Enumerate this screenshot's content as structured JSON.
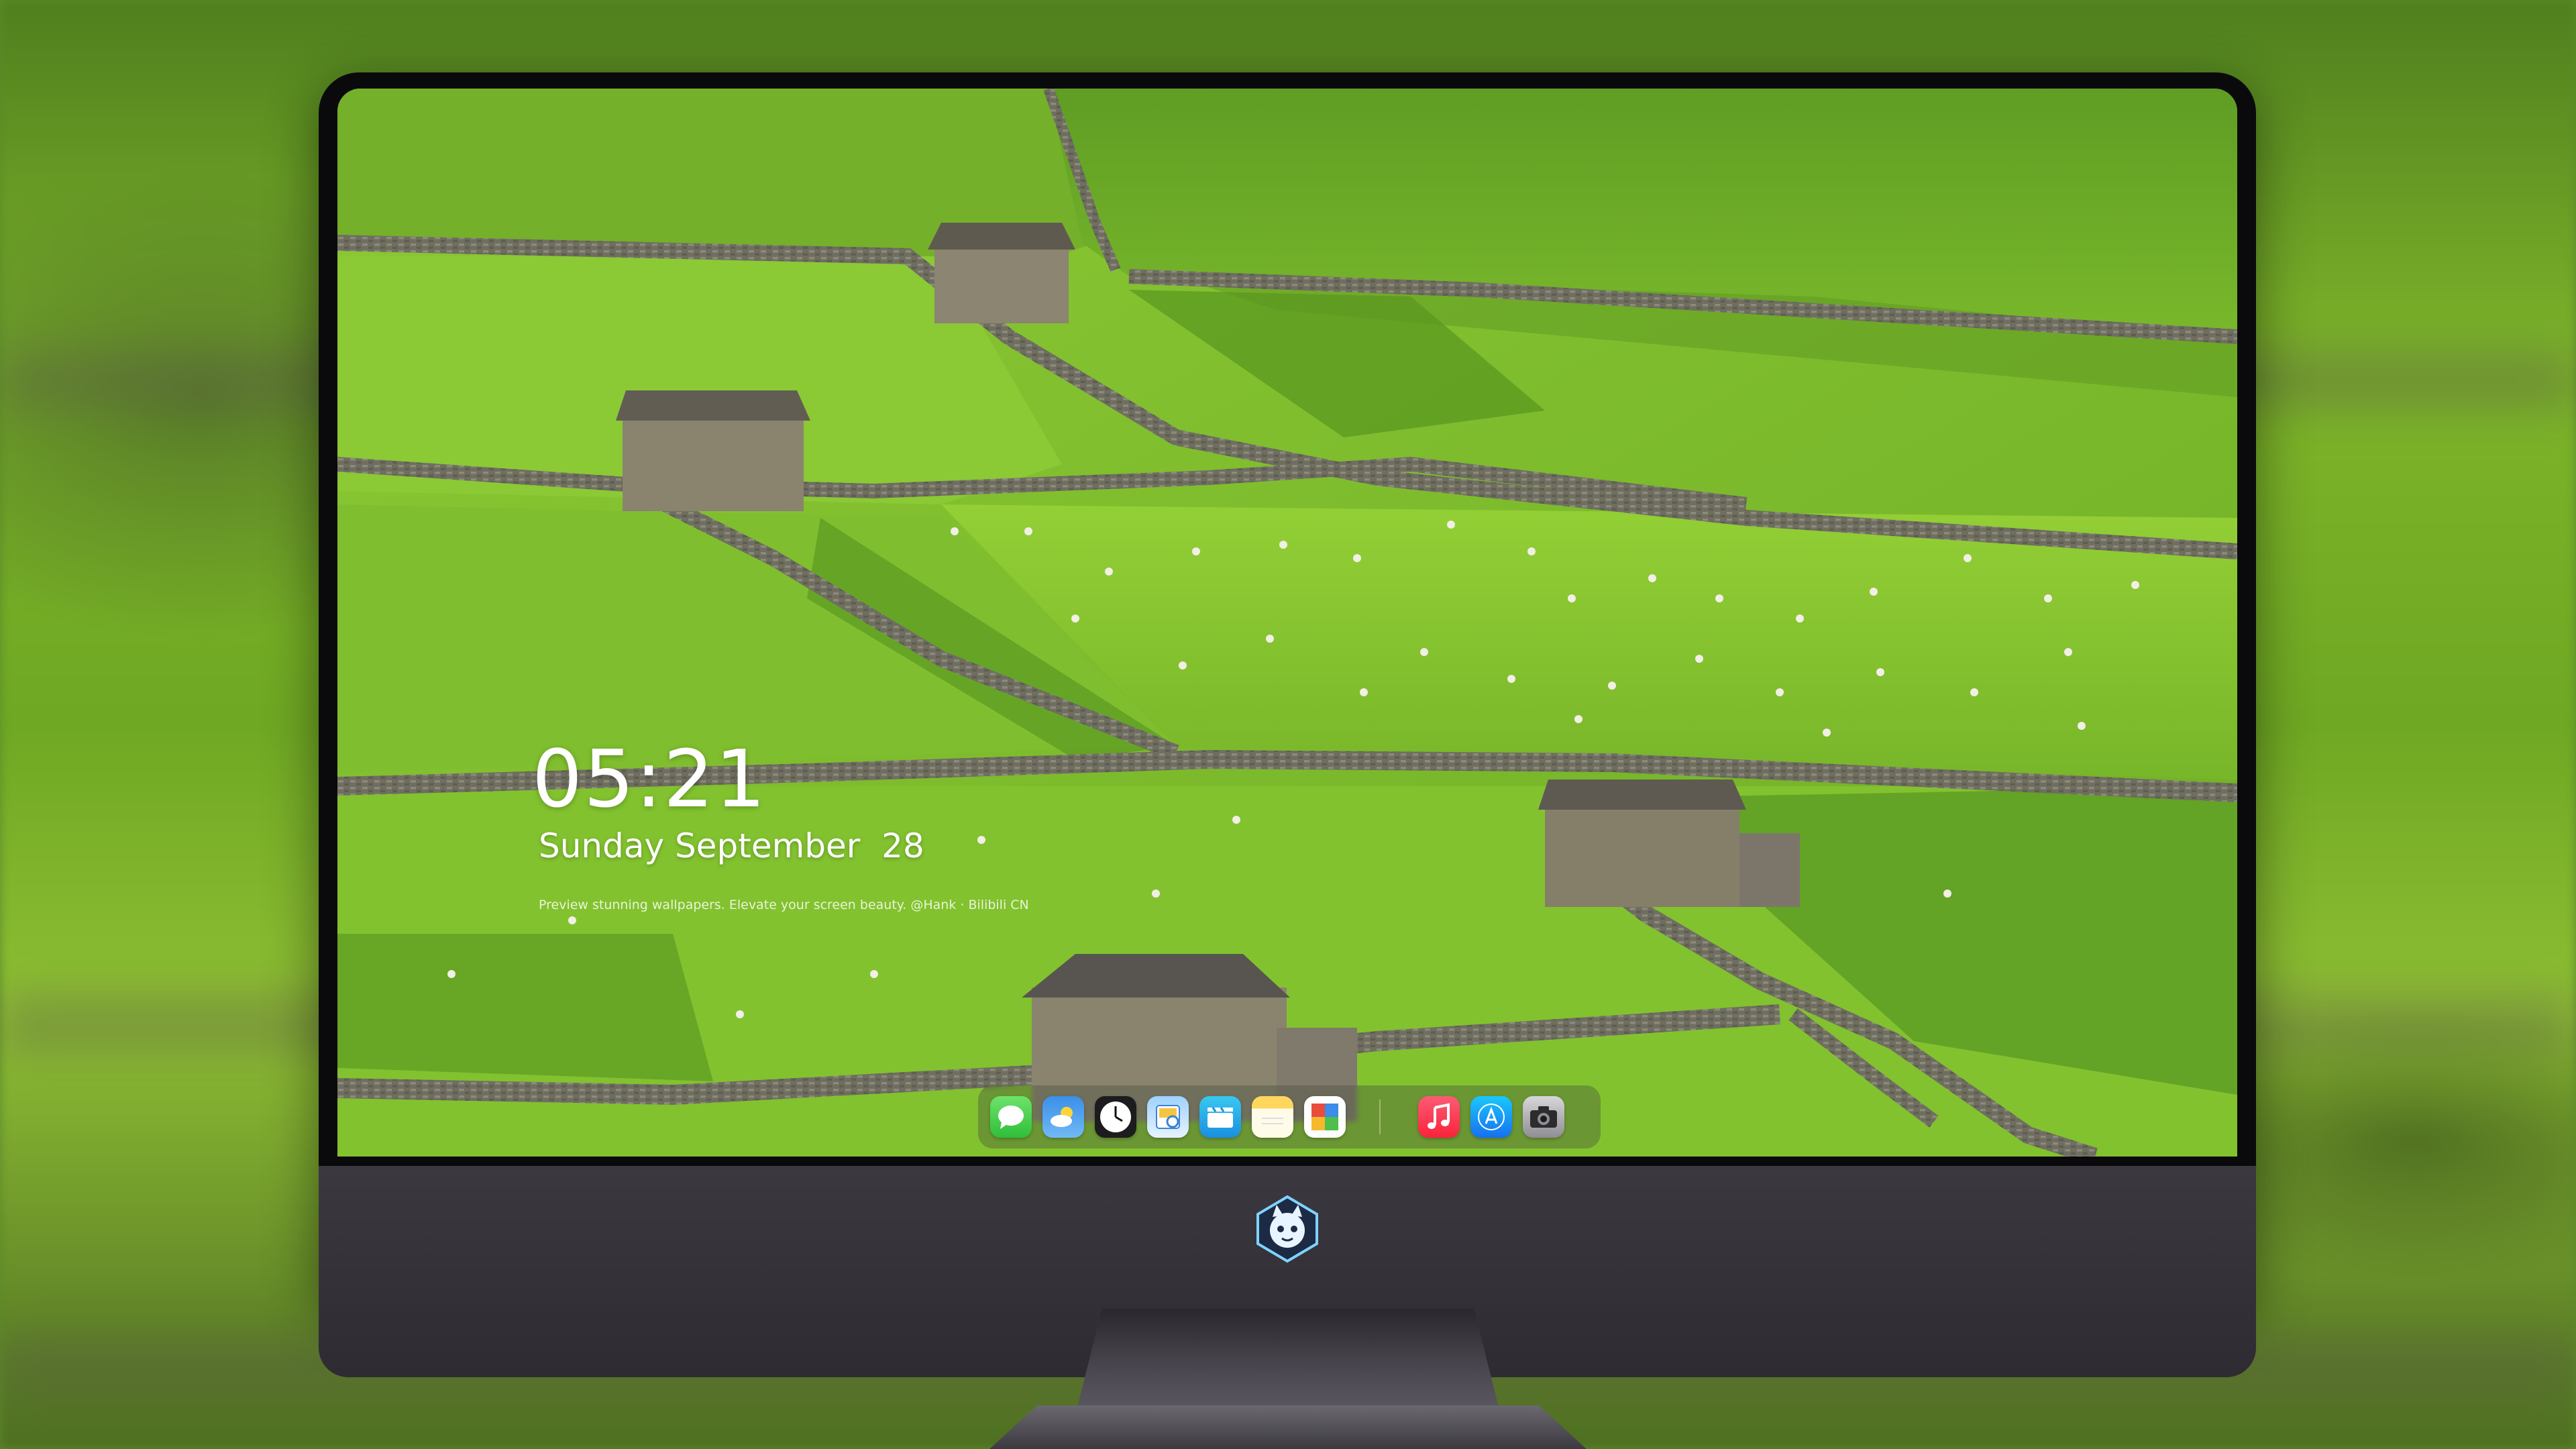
{
  "lock_screen": {
    "time": "05:21",
    "date": "Sunday September  28",
    "tagline": "Preview stunning wallpapers. Elevate your screen beauty. @Hank · Bilibili CN"
  },
  "dock": {
    "apps": [
      {
        "name": "Messages",
        "icon": "messages-icon"
      },
      {
        "name": "Weather",
        "icon": "weather-icon"
      },
      {
        "name": "Clock",
        "icon": "clock-icon"
      },
      {
        "name": "Preview",
        "icon": "preview-icon"
      },
      {
        "name": "Clips",
        "icon": "clips-icon"
      },
      {
        "name": "Notes",
        "icon": "notes-icon"
      },
      {
        "name": "Photo Booth",
        "icon": "photo-booth-icon"
      },
      {
        "name": "Music",
        "icon": "music-icon"
      },
      {
        "name": "App Store",
        "icon": "app-store-icon"
      },
      {
        "name": "Camera",
        "icon": "camera-icon"
      }
    ]
  },
  "colors": {
    "grass": "#7dbf2a",
    "wall": "#7c7a6a",
    "monitor_bezel": "#0a0a0c",
    "monitor_chin": "#3b3840"
  }
}
